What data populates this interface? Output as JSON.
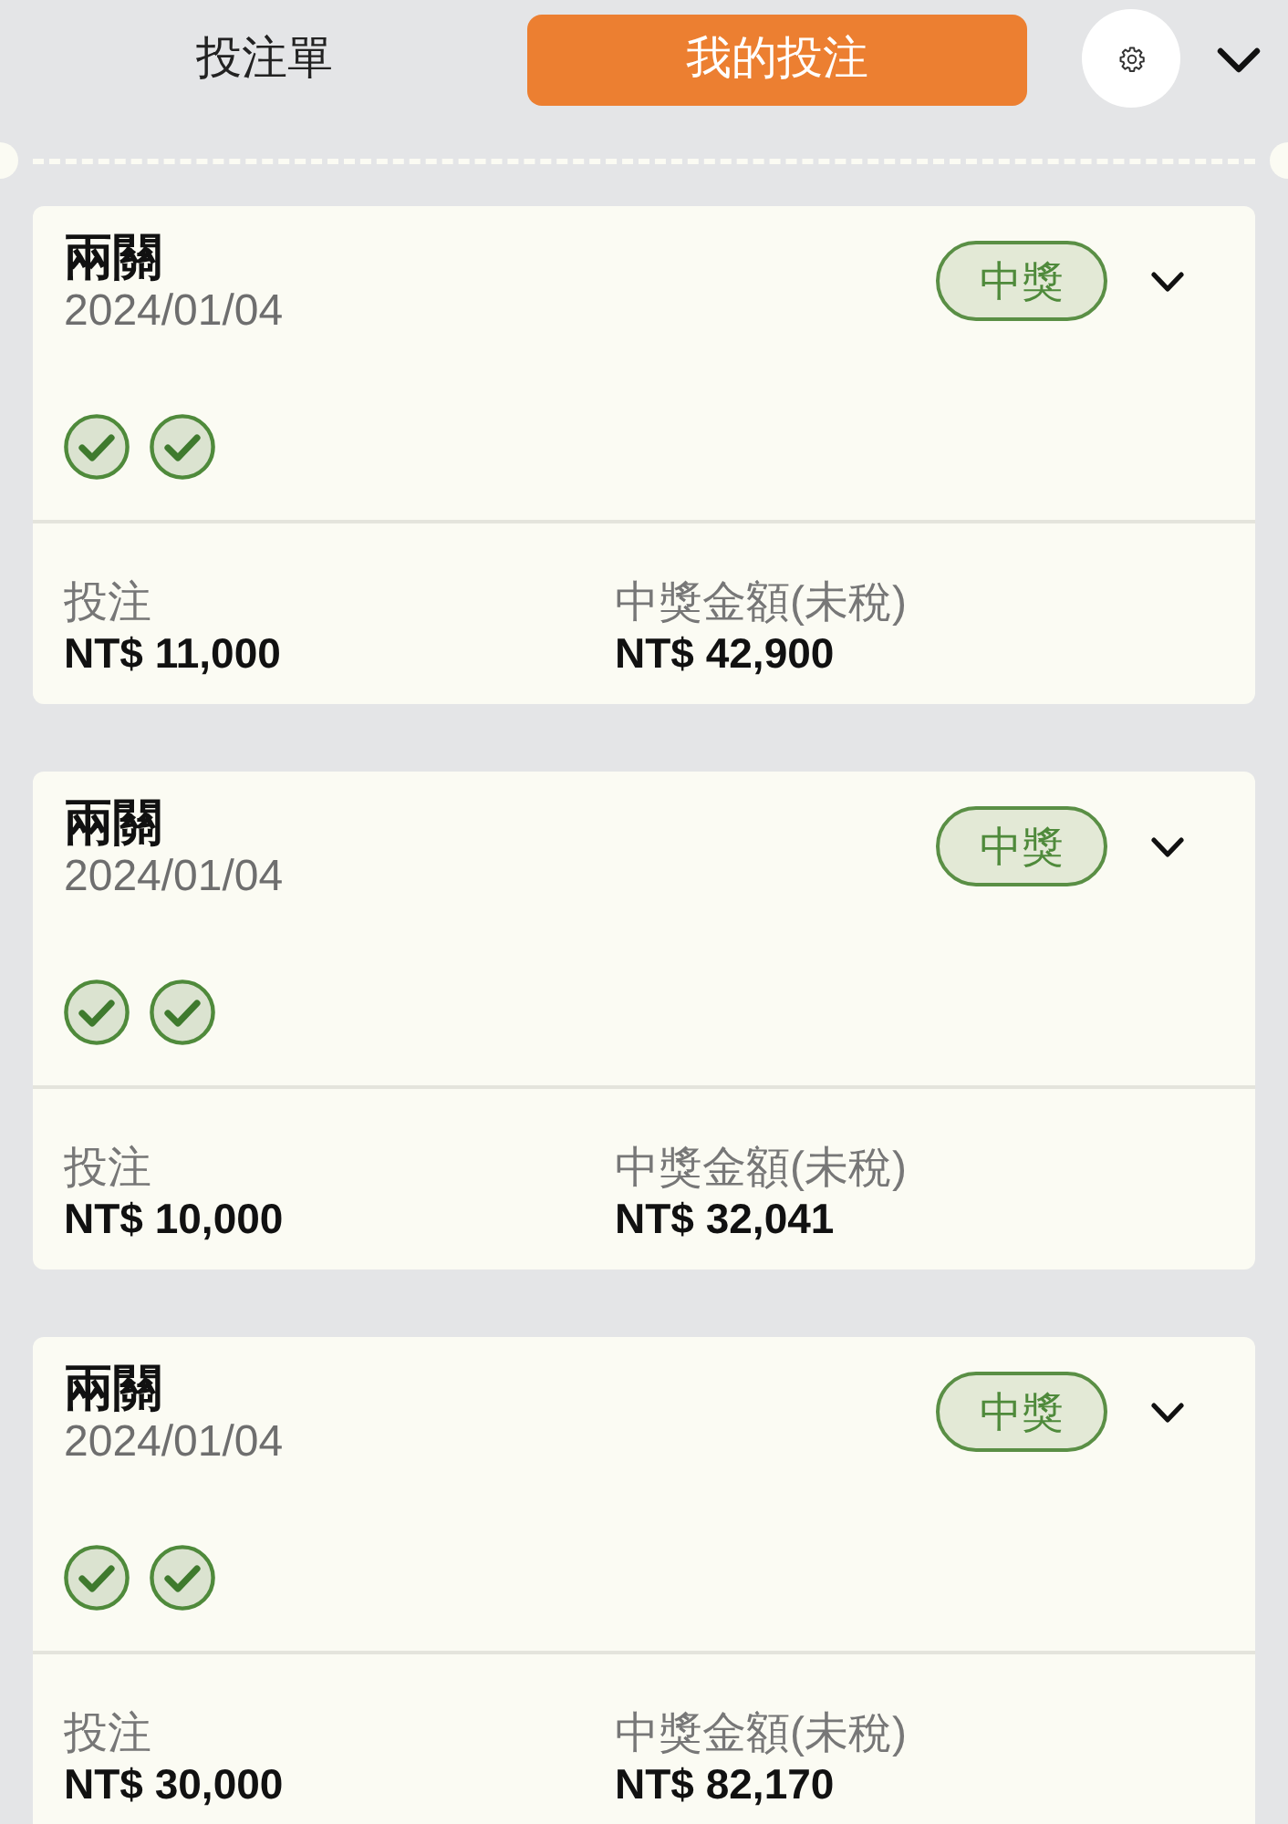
{
  "tabs": [
    {
      "label": "投注單",
      "selected": false
    },
    {
      "label": "我的投注",
      "selected": true
    }
  ],
  "bets": [
    {
      "title": "兩關",
      "date": "2024/01/04",
      "status": "中獎",
      "expanded": false,
      "legs": [
        {
          "won": true
        },
        {
          "won": true
        }
      ],
      "stake_label": "投注",
      "stake": "NT$ 11,000",
      "payout_label": "中獎金額(未稅)",
      "payout": "NT$ 42,900"
    },
    {
      "title": "兩關",
      "date": "2024/01/04",
      "status": "中獎",
      "expanded": false,
      "legs": [
        {
          "won": true
        },
        {
          "won": true
        }
      ],
      "stake_label": "投注",
      "stake": "NT$ 10,000",
      "payout_label": "中獎金額(未稅)",
      "payout": "NT$ 32,041"
    },
    {
      "title": "兩關",
      "date": "2024/01/04",
      "status": "中獎",
      "expanded": false,
      "legs": [
        {
          "won": true
        },
        {
          "won": true
        }
      ],
      "stake_label": "投注",
      "stake": "NT$ 30,000",
      "payout_label": "中獎金額(未稅)",
      "payout": "NT$ 82,170"
    }
  ]
}
